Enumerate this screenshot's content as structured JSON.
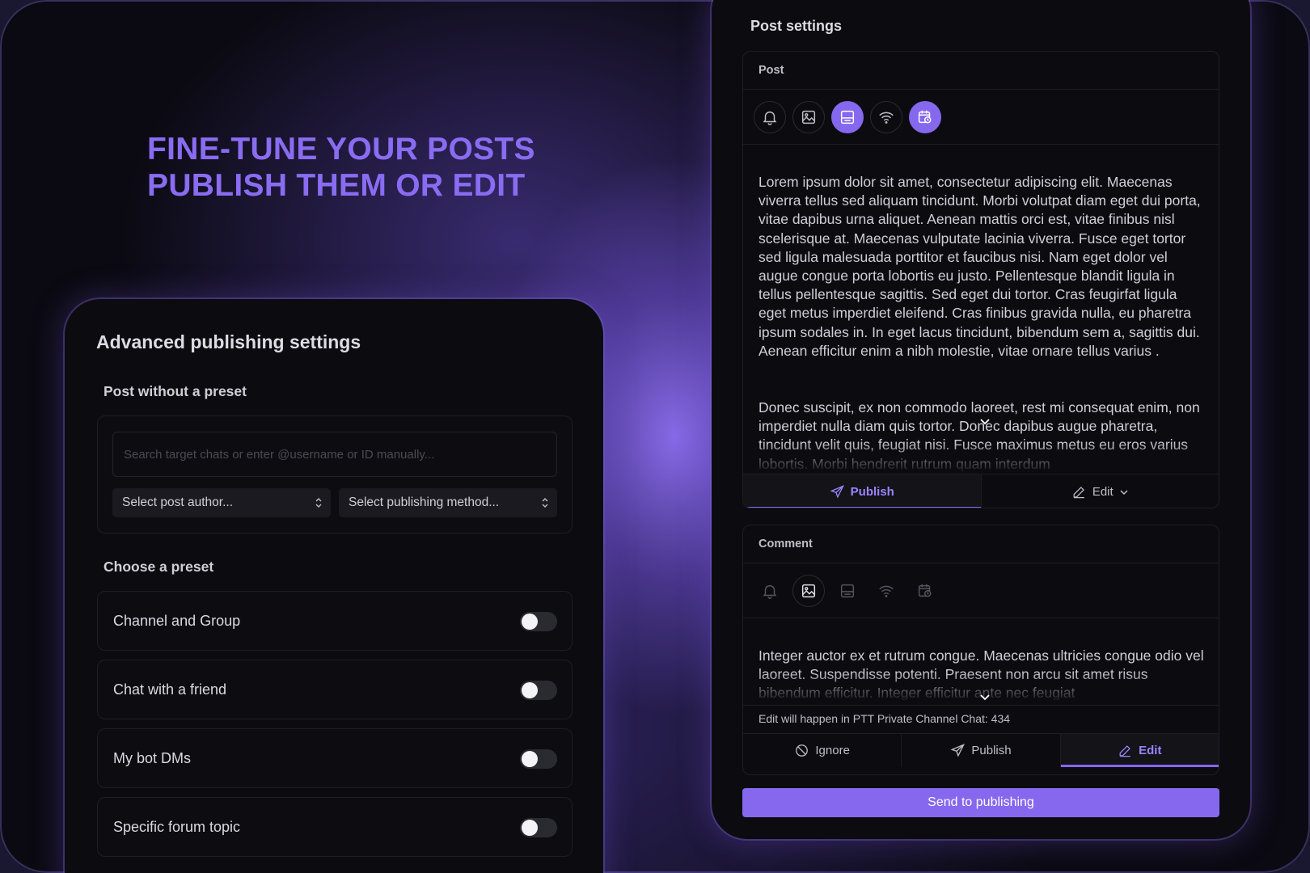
{
  "headline": {
    "line1": "FINE-TUNE YOUR POSTS",
    "line2": "PUBLISH THEM OR EDIT"
  },
  "advanced": {
    "title": "Advanced publishing settings",
    "without_preset_label": "Post without a preset",
    "search_placeholder": "Search target chats or enter @username or ID manually...",
    "author_select": "Select post author...",
    "method_select": "Select publishing method...",
    "choose_preset_label": "Choose a preset",
    "presets": [
      {
        "label": "Channel and Group",
        "enabled": false
      },
      {
        "label": "Chat with a friend",
        "enabled": false
      },
      {
        "label": "My bot DMs",
        "enabled": false
      },
      {
        "label": "Specific forum topic",
        "enabled": false
      }
    ]
  },
  "post_settings": {
    "title": "Post settings",
    "post": {
      "header": "Post",
      "icons": [
        {
          "name": "bell-icon",
          "active": false
        },
        {
          "name": "image-icon",
          "active": false
        },
        {
          "name": "preview-icon",
          "active": true
        },
        {
          "name": "wifi-icon",
          "active": false
        },
        {
          "name": "calendar-clock-icon",
          "active": true
        }
      ],
      "paragraph1": "Lorem ipsum dolor sit amet, consectetur adipiscing elit. Maecenas viverra tellus sed aliquam tincidunt. Morbi volutpat diam eget dui porta, vitae dapibus urna aliquet. Aenean mattis orci est, vitae finibus nisl scelerisque at. Maecenas vulputate lacinia viverra. Fusce eget tortor sed ligula malesuada porttitor et faucibus nisi. Nam eget dolor vel augue congue porta lobortis eu justo. Pellentesque blandit ligula in tellus pellentesque sagittis. Sed eget dui tortor. Cras feugirfat ligula eget metus imperdiet eleifend. Cras finibus gravida nulla, eu pharetra ipsum sodales in. In eget lacus tincidunt, bibendum sem a, sagittis dui. Aenean efficitur enim a nibh molestie, vitae ornare tellus varius .",
      "paragraph2": "Donec suscipit, ex non commodo laoreet, rest mi consequat enim, non imperdiet nulla diam quis tortor. Donec dapibus augue pharetra, tincidunt velit quis, feugiat nisi. Fusce maximus metus eu eros varius lobortis. Morbi hendrerit rutrum quam interdum",
      "tabs": [
        {
          "label": "Publish",
          "icon": "send-icon",
          "active": true
        },
        {
          "label": "Edit",
          "icon": "pencil-icon",
          "active": false,
          "dropdown": true
        }
      ]
    },
    "comment": {
      "header": "Comment",
      "icons": [
        {
          "name": "bell-icon",
          "active": false
        },
        {
          "name": "image-icon",
          "active": true
        },
        {
          "name": "preview-icon",
          "active": false
        },
        {
          "name": "wifi-icon",
          "active": false
        },
        {
          "name": "calendar-clock-icon",
          "active": false
        }
      ],
      "text": "Integer auctor ex et rutrum congue. Maecenas ultricies congue odio vel laoreet. Suspendisse potenti. Praesent non arcu sit amet risus bibendum efficitur. Integer efficitur ante nec feugiat",
      "edit_note": "Edit will happen in PTT Private Channel Chat: 434",
      "tabs": [
        {
          "label": "Ignore",
          "icon": "ban-icon",
          "active": false
        },
        {
          "label": "Publish",
          "icon": "send-icon",
          "active": false
        },
        {
          "label": "Edit",
          "icon": "pencil-icon",
          "active": true
        }
      ]
    },
    "send_button": "Send to publishing"
  }
}
